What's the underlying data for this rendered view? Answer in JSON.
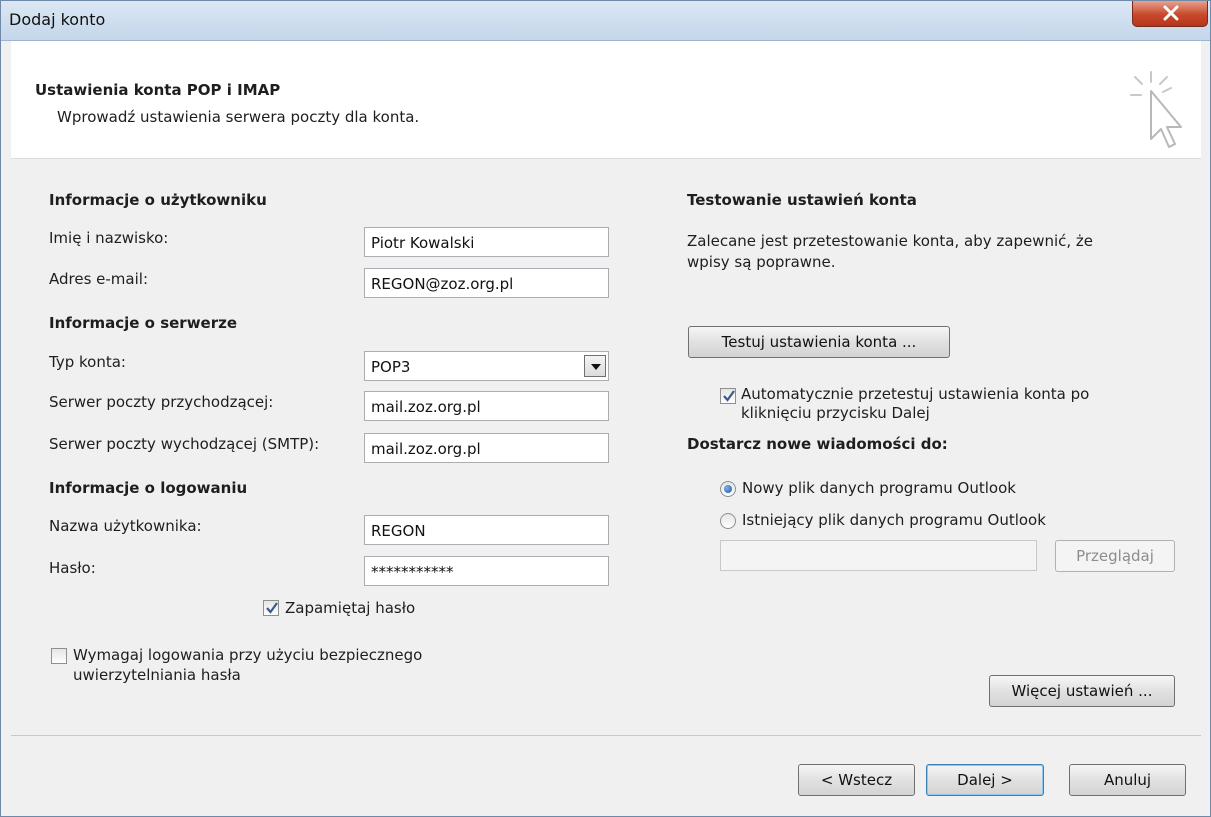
{
  "window": {
    "title": "Dodaj konto",
    "close_icon": "close-icon"
  },
  "header": {
    "title": "Ustawienia konta POP i IMAP",
    "subtitle": "Wprowadź ustawienia serwera poczty dla konta."
  },
  "user_info": {
    "section": "Informacje o użytkowniku",
    "name_label": "Imię i nazwisko:",
    "name_value": "Piotr Kowalski",
    "email_label": "Adres e-mail:",
    "email_value": "REGON@zoz.org.pl"
  },
  "server_info": {
    "section": "Informacje o serwerze",
    "type_label": "Typ konta:",
    "type_value": "POP3",
    "incoming_label": "Serwer poczty przychodzącej:",
    "incoming_value": "mail.zoz.org.pl",
    "outgoing_label": "Serwer poczty wychodzącej (SMTP):",
    "outgoing_value": "mail.zoz.org.pl"
  },
  "login_info": {
    "section": "Informacje o logowaniu",
    "username_label": "Nazwa użytkownika:",
    "username_value": "REGON",
    "password_label": "Hasło:",
    "password_value": "***********",
    "remember_label": "Zapamiętaj hasło",
    "remember_checked": true,
    "spa_label_line1": "Wymagaj logowania przy użyciu bezpiecznego",
    "spa_label_line2": "uwierzytelniania hasła",
    "spa_checked": false
  },
  "test": {
    "section": "Testowanie ustawień konta",
    "desc_line1": "Zalecane jest przetestowanie konta, aby zapewnić, że",
    "desc_line2": "wpisy są poprawne.",
    "button": "Testuj ustawienia konta ...",
    "auto_label_line1": "Automatycznie przetestuj ustawienia konta po",
    "auto_label_line2": "kliknięciu przycisku Dalej",
    "auto_checked": true
  },
  "delivery": {
    "section": "Dostarcz nowe wiadomości do:",
    "option_new": "Nowy plik danych programu Outlook",
    "option_existing": "Istniejący plik danych programu Outlook",
    "selected": "new",
    "browse_button": "Przeglądaj"
  },
  "more_settings_button": "Więcej ustawień ...",
  "footer": {
    "back": "< Wstecz",
    "next": "Dalej >",
    "cancel": "Anuluj"
  }
}
